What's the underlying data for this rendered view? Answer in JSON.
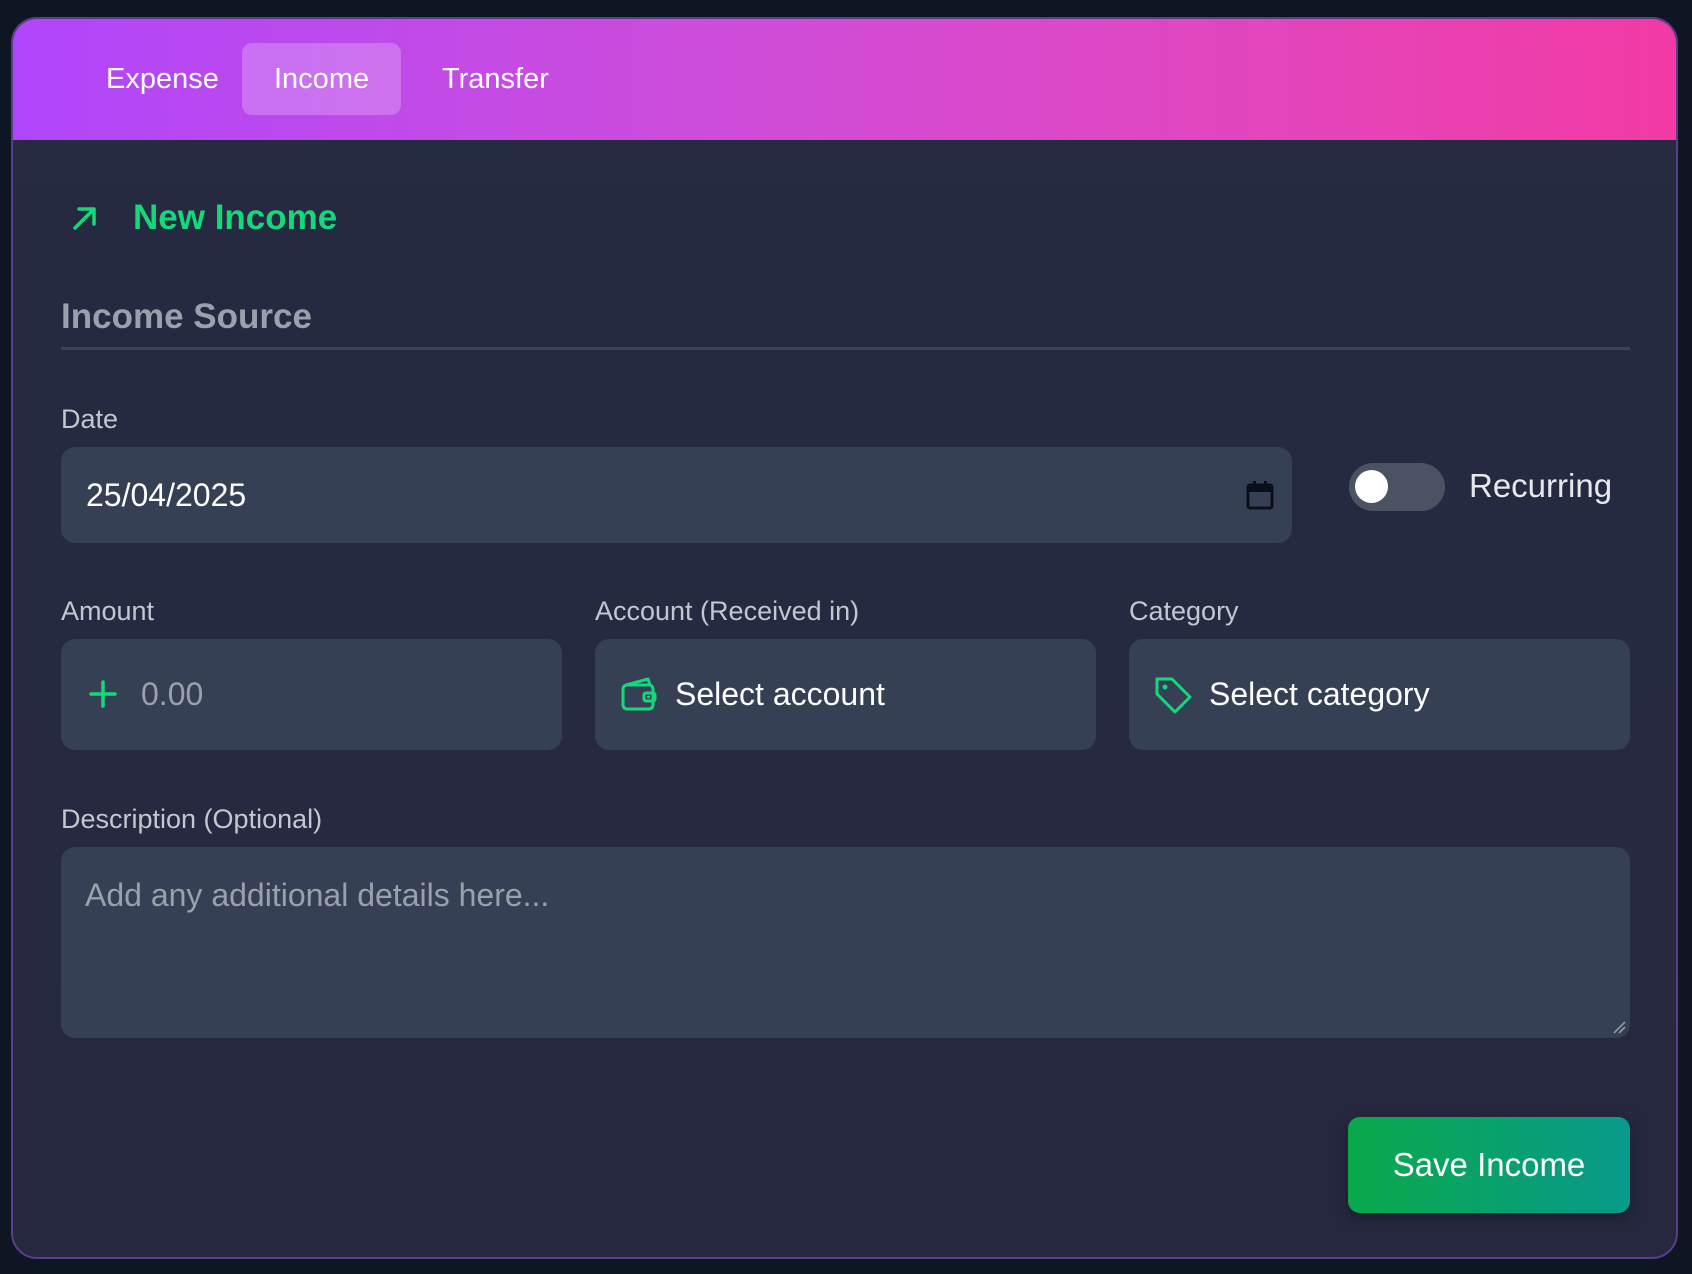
{
  "tabs": [
    {
      "label": "Expense"
    },
    {
      "label": "Income"
    },
    {
      "label": "Transfer"
    }
  ],
  "active_tab": "Income",
  "form": {
    "heading": "New Income",
    "heading_icon": "arrow-up-right-icon",
    "section_title": "Income Source",
    "date": {
      "label": "Date",
      "value": "25/04/2025",
      "icon": "calendar-icon"
    },
    "recurring": {
      "label": "Recurring",
      "enabled": false
    },
    "amount": {
      "label": "Amount",
      "placeholder": "0.00",
      "icon": "plus-icon"
    },
    "account": {
      "label": "Account (Received in)",
      "value": "Select account",
      "icon": "wallet-icon"
    },
    "category": {
      "label": "Category",
      "value": "Select category",
      "icon": "tag-icon"
    },
    "description": {
      "label": "Description (Optional)",
      "placeholder": "Add any additional details here..."
    },
    "save_label": "Save Income"
  },
  "colors": {
    "accent_green": "#13d97a",
    "header_gradient_start": "#b046fb",
    "header_gradient_end": "#f23aa3",
    "field_bg": "#364054",
    "panel_bg": "#252b41"
  }
}
